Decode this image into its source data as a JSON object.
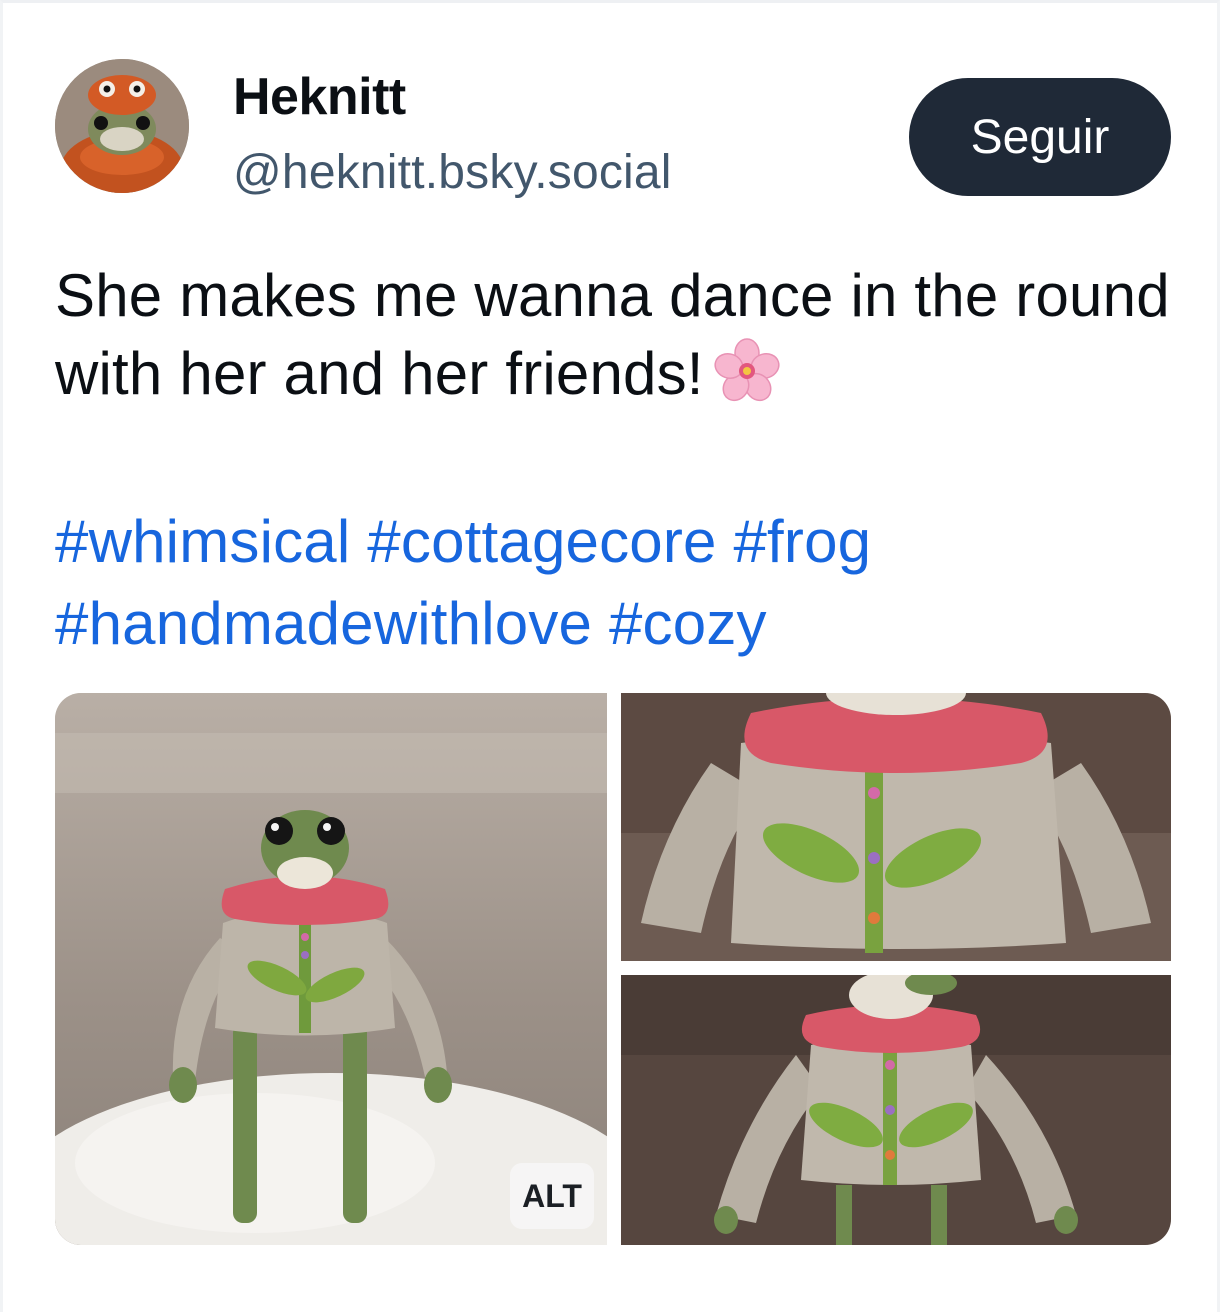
{
  "author": {
    "display_name": "Heknitt",
    "handle": "@heknitt.bsky.social",
    "avatar_icon": "knitted-frog-avatar"
  },
  "follow_button": {
    "label": "Seguir"
  },
  "post": {
    "text": "She makes me wanna dance in the round with her and her friends!",
    "emoji": "cherry-blossom",
    "hashtags": [
      "#whimsical",
      "#cottagecore",
      "#frog",
      "#handmadewithlove",
      "#cozy"
    ]
  },
  "images": {
    "count": 3,
    "alt_badge": "ALT"
  },
  "colors": {
    "follow_bg": "#1f2937",
    "hashtag": "#1766de",
    "handle": "#42576c"
  }
}
